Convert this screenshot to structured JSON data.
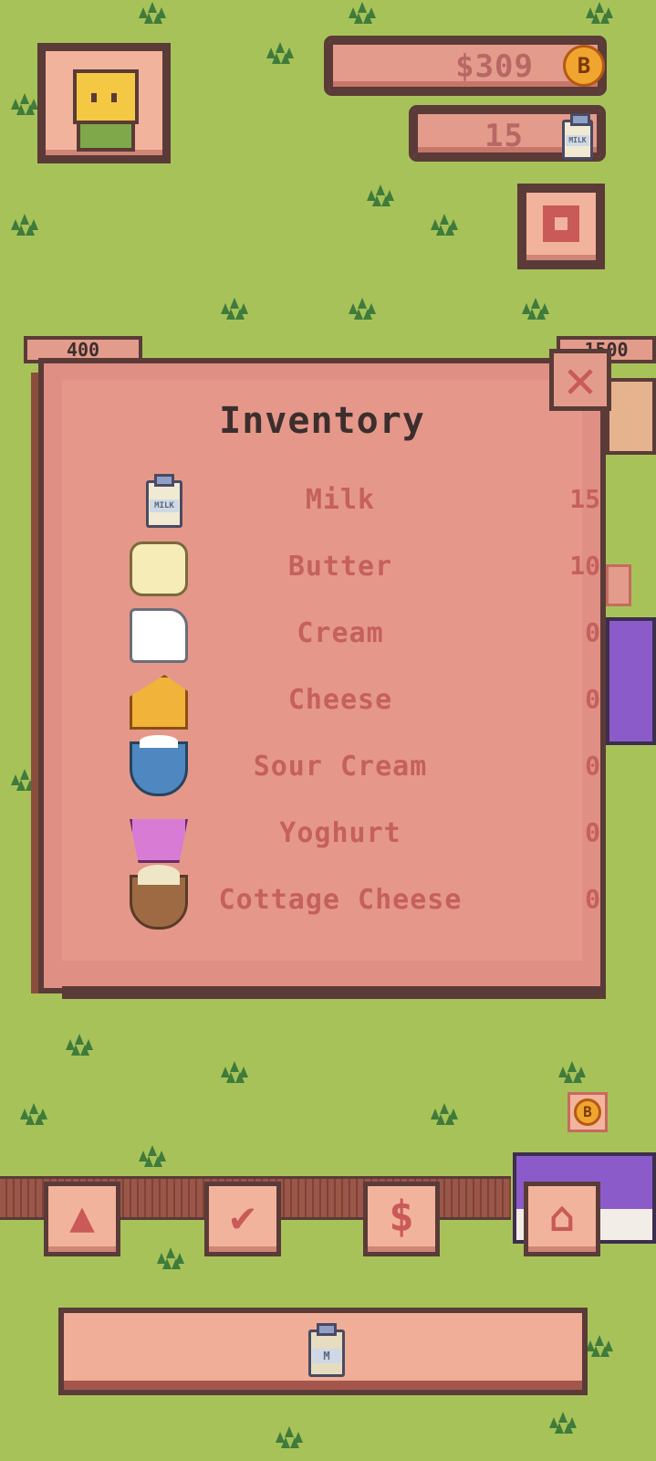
{
  "hud": {
    "money": "$309",
    "money_coin": "B",
    "milk_count": "15",
    "milk_bottle_label": "MILK"
  },
  "side_tags": {
    "left_value": "400",
    "right_value": "1500"
  },
  "inventory": {
    "title": "Inventory",
    "items": [
      {
        "name": "Milk",
        "qty": "15",
        "icon": "milk-bottle-icon"
      },
      {
        "name": "Butter",
        "qty": "10",
        "icon": "butter-icon"
      },
      {
        "name": "Cream",
        "qty": "0",
        "icon": "cream-jug-icon"
      },
      {
        "name": "Cheese",
        "qty": "0",
        "icon": "cheese-icon"
      },
      {
        "name": "Sour Cream",
        "qty": "0",
        "icon": "sour-cream-bowl-icon"
      },
      {
        "name": "Yoghurt",
        "qty": "0",
        "icon": "yoghurt-cup-icon"
      },
      {
        "name": "Cottage Cheese",
        "qty": "0",
        "icon": "cottage-cheese-bowl-icon"
      }
    ]
  },
  "barn_coin": "B",
  "bottom": {
    "milk_button_label": "M"
  },
  "colors": {
    "grass": "#a8c25a",
    "panel": "#e39c8b",
    "outline": "#5a3b38",
    "accent_red": "#c95a58"
  }
}
